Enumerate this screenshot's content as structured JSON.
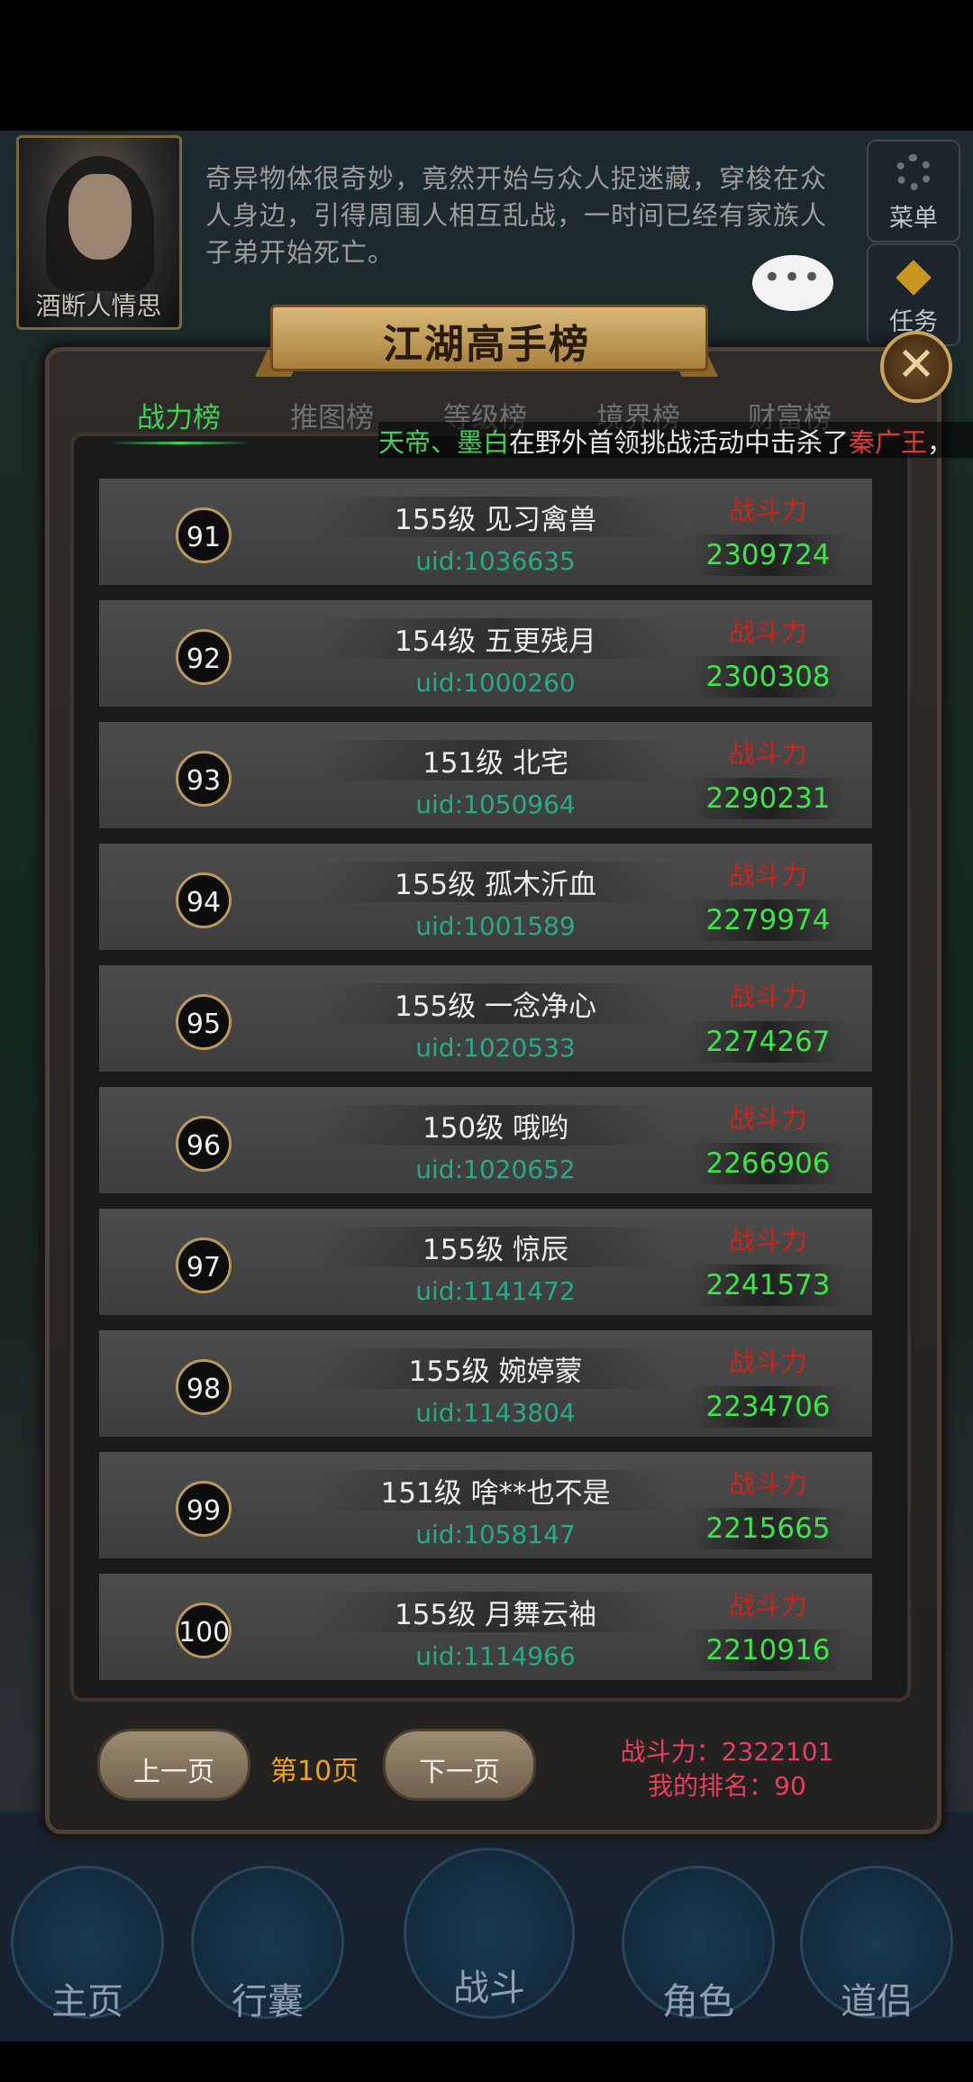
{
  "header": {
    "avatar_name": "酒断人情思",
    "story_lines": [
      "奇异物体很奇妙，竟然开始与众人捉迷藏，穿梭在众",
      "人身边，引得周围人相互乱战，一时间已经有家族人",
      "子弟开始死亡。"
    ],
    "chat_bubble": "•••",
    "menu_label": "菜单",
    "task_label": "任务"
  },
  "panel": {
    "title": "江湖高手榜",
    "close_symbol": "✕",
    "tabs": [
      "战力榜",
      "推图榜",
      "等级榜",
      "境界榜",
      "财富榜"
    ],
    "active_tab": "战力榜",
    "marquee": {
      "names": "天帝、墨白",
      "middle": "在野外首领挑战活动中击杀了",
      "target": "秦广王",
      "tail": "，"
    },
    "power_label": "战斗力",
    "rows": [
      {
        "rank": "91",
        "name": "155级 见习禽兽",
        "uid": "uid:1036635",
        "power": "2309724"
      },
      {
        "rank": "92",
        "name": "154级 五更残月",
        "uid": "uid:1000260",
        "power": "2300308"
      },
      {
        "rank": "93",
        "name": "151级 北宅",
        "uid": "uid:1050964",
        "power": "2290231"
      },
      {
        "rank": "94",
        "name": "155级 孤木沂血",
        "uid": "uid:1001589",
        "power": "2279974"
      },
      {
        "rank": "95",
        "name": "155级 一念净心",
        "uid": "uid:1020533",
        "power": "2274267"
      },
      {
        "rank": "96",
        "name": "150级 哦哟",
        "uid": "uid:1020652",
        "power": "2266906"
      },
      {
        "rank": "97",
        "name": "155级 惊辰",
        "uid": "uid:1141472",
        "power": "2241573"
      },
      {
        "rank": "98",
        "name": "155级 婉婷蒙",
        "uid": "uid:1143804",
        "power": "2234706"
      },
      {
        "rank": "99",
        "name": "151级 啥**也不是",
        "uid": "uid:1058147",
        "power": "2215665"
      },
      {
        "rank": "100",
        "name": "155级 月舞云袖",
        "uid": "uid:1114966",
        "power": "2210916"
      }
    ],
    "prev_label": "上一页",
    "page_label": "第10页",
    "next_label": "下一页",
    "my_power": "战斗力：2322101",
    "my_rank": "我的排名：90"
  },
  "nav": [
    "主页",
    "行囊",
    "战斗",
    "角色",
    "道侣"
  ],
  "colors": {
    "green": "#3fd25a",
    "red": "#c8251e",
    "gold": "#f0a21f",
    "uid": "#2aa888"
  }
}
